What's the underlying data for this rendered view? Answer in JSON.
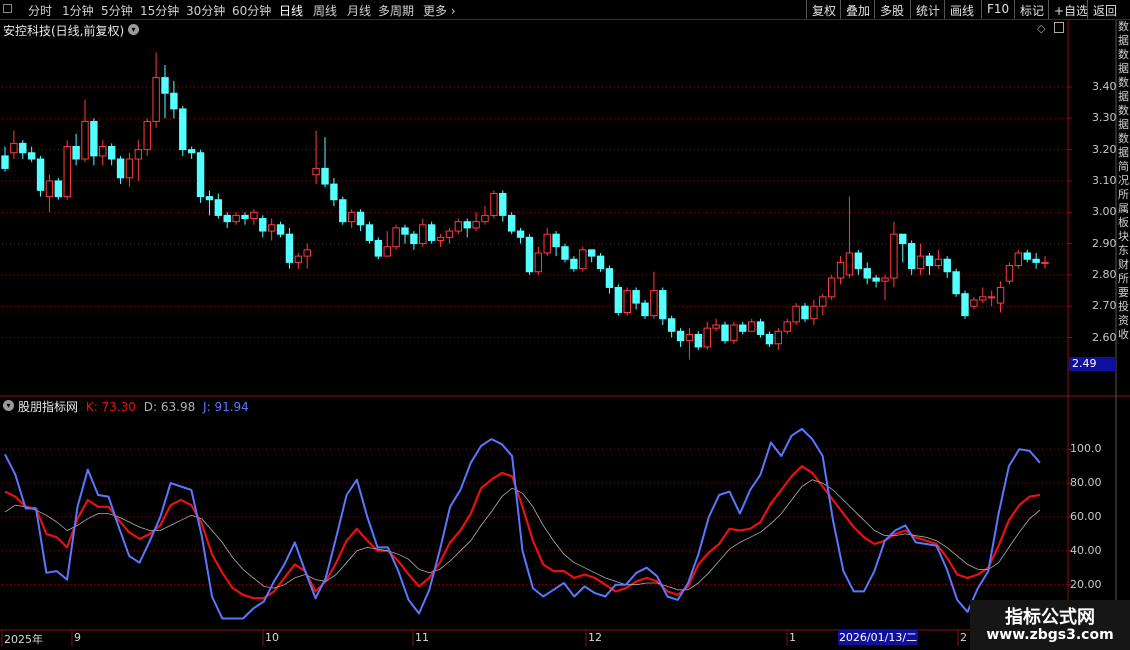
{
  "toolbar": {
    "periods": [
      {
        "label": "分时",
        "active": false
      },
      {
        "label": "1分钟",
        "active": false
      },
      {
        "label": "5分钟",
        "active": false
      },
      {
        "label": "15分钟",
        "active": false
      },
      {
        "label": "30分钟",
        "active": false
      },
      {
        "label": "60分钟",
        "active": false
      },
      {
        "label": "日线",
        "active": true
      },
      {
        "label": "周线",
        "active": false
      },
      {
        "label": "月线",
        "active": false
      },
      {
        "label": "多周期",
        "active": false
      },
      {
        "label": "更多",
        "active": false
      }
    ],
    "right_buttons": [
      "复权",
      "叠加",
      "多股",
      "统计",
      "画线",
      "F10",
      "标记",
      "+自选",
      "返回"
    ]
  },
  "stock": {
    "title": "安控科技(日线,前复权)",
    "current_price_tag": "2.49"
  },
  "indicator": {
    "name": "股朋指标网",
    "k": "K: 73.30",
    "d": "D: 63.98",
    "j": "J: 91.94"
  },
  "colors": {
    "up": "#ff3c3c",
    "down": "#54ffff",
    "k_line": "#e81010",
    "d_line": "#b0b0b0",
    "j_line": "#5a78ff",
    "grid": "#8a1010",
    "price_tag_bg": "#1010a0"
  },
  "price_axis": [
    "3.40",
    "3.30",
    "3.20",
    "3.10",
    "3.00",
    "2.90",
    "2.80",
    "2.70",
    "2.60"
  ],
  "kdj_axis": [
    "100.0",
    "80.00",
    "60.00",
    "40.00",
    "20.00"
  ],
  "date_axis": [
    {
      "label": "2025年"
    },
    {
      "label": "9"
    },
    {
      "label": "10"
    },
    {
      "label": "11"
    },
    {
      "label": "12"
    },
    {
      "label": "1"
    },
    {
      "label": "2"
    }
  ],
  "cursor_date": "2026/01/13/二",
  "side_strip_chars": [
    "数",
    "据",
    "数",
    "据",
    "数",
    "据",
    "数",
    "据",
    "数",
    "据",
    "简",
    "况",
    "所",
    "属",
    "板",
    "块",
    "东",
    "财",
    "所",
    "要",
    "投",
    "资",
    "收"
  ],
  "watermark": {
    "line1": "指标公式网",
    "line2": "www.zbgs3.com"
  },
  "chart_data": [
    {
      "type": "candlestick",
      "title": "安控科技(日线,前复权)",
      "ylim": [
        2.49,
        3.55
      ],
      "candles": [
        [
          3.18,
          3.14,
          3.21,
          3.13
        ],
        [
          3.19,
          3.22,
          3.26,
          3.17
        ],
        [
          3.22,
          3.19,
          3.23,
          3.17
        ],
        [
          3.19,
          3.17,
          3.21,
          3.16
        ],
        [
          3.17,
          3.07,
          3.18,
          3.05
        ],
        [
          3.05,
          3.1,
          3.12,
          3.0
        ],
        [
          3.1,
          3.05,
          3.11,
          3.04
        ],
        [
          3.05,
          3.21,
          3.23,
          3.04
        ],
        [
          3.21,
          3.17,
          3.25,
          3.15
        ],
        [
          3.17,
          3.29,
          3.36,
          3.16
        ],
        [
          3.29,
          3.18,
          3.3,
          3.15
        ],
        [
          3.18,
          3.21,
          3.23,
          3.15
        ],
        [
          3.21,
          3.17,
          3.22,
          3.15
        ],
        [
          3.17,
          3.11,
          3.18,
          3.09
        ],
        [
          3.11,
          3.17,
          3.19,
          3.08
        ],
        [
          3.17,
          3.2,
          3.23,
          3.1
        ],
        [
          3.2,
          3.29,
          3.3,
          3.18
        ],
        [
          3.29,
          3.43,
          3.51,
          3.27
        ],
        [
          3.43,
          3.38,
          3.47,
          3.3
        ],
        [
          3.38,
          3.33,
          3.42,
          3.3
        ],
        [
          3.33,
          3.2,
          3.34,
          3.18
        ],
        [
          3.2,
          3.19,
          3.21,
          3.17
        ],
        [
          3.19,
          3.05,
          3.2,
          3.03
        ],
        [
          3.05,
          3.04,
          3.07,
          2.99
        ],
        [
          3.04,
          2.99,
          3.06,
          2.98
        ],
        [
          2.99,
          2.97,
          3.0,
          2.95
        ],
        [
          2.97,
          2.99,
          3.0,
          2.96
        ],
        [
          2.99,
          2.98,
          3.0,
          2.96
        ],
        [
          2.98,
          3.0,
          3.01,
          2.96
        ],
        [
          2.98,
          2.94,
          2.99,
          2.92
        ],
        [
          2.94,
          2.96,
          2.98,
          2.91
        ],
        [
          2.96,
          2.93,
          2.97,
          2.92
        ],
        [
          2.93,
          2.84,
          2.95,
          2.82
        ],
        [
          2.84,
          2.86,
          2.87,
          2.82
        ],
        [
          2.86,
          2.88,
          2.9,
          2.82
        ],
        [
          3.12,
          3.14,
          3.26,
          3.09
        ],
        [
          3.14,
          3.09,
          3.24,
          3.08
        ],
        [
          3.09,
          3.04,
          3.11,
          3.02
        ],
        [
          3.04,
          2.97,
          3.05,
          2.96
        ],
        [
          2.97,
          3.0,
          3.01,
          2.95
        ],
        [
          3.0,
          2.96,
          3.01,
          2.94
        ],
        [
          2.96,
          2.91,
          2.97,
          2.9
        ],
        [
          2.91,
          2.86,
          2.92,
          2.85
        ],
        [
          2.86,
          2.89,
          2.94,
          2.86
        ],
        [
          2.89,
          2.95,
          2.96,
          2.88
        ],
        [
          2.95,
          2.93,
          2.96,
          2.9
        ],
        [
          2.93,
          2.9,
          2.94,
          2.88
        ],
        [
          2.9,
          2.96,
          2.98,
          2.89
        ],
        [
          2.96,
          2.91,
          2.97,
          2.9
        ],
        [
          2.91,
          2.92,
          2.93,
          2.89
        ],
        [
          2.92,
          2.94,
          2.95,
          2.9
        ],
        [
          2.94,
          2.97,
          2.98,
          2.93
        ],
        [
          2.97,
          2.95,
          2.98,
          2.92
        ],
        [
          2.95,
          2.97,
          3.0,
          2.94
        ],
        [
          2.97,
          2.99,
          3.02,
          2.96
        ],
        [
          2.99,
          3.06,
          3.07,
          2.98
        ],
        [
          3.06,
          2.99,
          3.07,
          2.97
        ],
        [
          2.99,
          2.94,
          3.0,
          2.93
        ],
        [
          2.94,
          2.92,
          2.95,
          2.9
        ],
        [
          2.92,
          2.81,
          2.93,
          2.8
        ],
        [
          2.81,
          2.87,
          2.89,
          2.8
        ],
        [
          2.87,
          2.93,
          2.95,
          2.86
        ],
        [
          2.93,
          2.89,
          2.94,
          2.86
        ],
        [
          2.89,
          2.85,
          2.9,
          2.84
        ],
        [
          2.85,
          2.82,
          2.86,
          2.81
        ],
        [
          2.82,
          2.88,
          2.89,
          2.81
        ],
        [
          2.88,
          2.86,
          2.88,
          2.84
        ],
        [
          2.86,
          2.82,
          2.87,
          2.81
        ],
        [
          2.82,
          2.76,
          2.83,
          2.74
        ],
        [
          2.76,
          2.68,
          2.77,
          2.67
        ],
        [
          2.68,
          2.75,
          2.76,
          2.67
        ],
        [
          2.75,
          2.71,
          2.76,
          2.69
        ],
        [
          2.71,
          2.67,
          2.72,
          2.66
        ],
        [
          2.67,
          2.75,
          2.81,
          2.66
        ],
        [
          2.75,
          2.66,
          2.76,
          2.64
        ],
        [
          2.66,
          2.62,
          2.67,
          2.6
        ],
        [
          2.62,
          2.59,
          2.63,
          2.57
        ],
        [
          2.59,
          2.61,
          2.63,
          2.53
        ],
        [
          2.61,
          2.57,
          2.62,
          2.56
        ],
        [
          2.57,
          2.63,
          2.65,
          2.56
        ],
        [
          2.63,
          2.64,
          2.66,
          2.62
        ],
        [
          2.64,
          2.59,
          2.65,
          2.58
        ],
        [
          2.59,
          2.64,
          2.65,
          2.58
        ],
        [
          2.64,
          2.62,
          2.65,
          2.61
        ],
        [
          2.62,
          2.65,
          2.66,
          2.63
        ],
        [
          2.65,
          2.61,
          2.66,
          2.6
        ],
        [
          2.61,
          2.58,
          2.62,
          2.57
        ],
        [
          2.58,
          2.62,
          2.63,
          2.56
        ],
        [
          2.62,
          2.65,
          2.66,
          2.61
        ],
        [
          2.65,
          2.7,
          2.71,
          2.64
        ],
        [
          2.7,
          2.66,
          2.71,
          2.65
        ],
        [
          2.66,
          2.7,
          2.72,
          2.64
        ],
        [
          2.7,
          2.73,
          2.74,
          2.67
        ],
        [
          2.73,
          2.79,
          2.8,
          2.72
        ],
        [
          2.79,
          2.84,
          2.86,
          2.77
        ],
        [
          2.8,
          2.87,
          3.05,
          2.79
        ],
        [
          2.87,
          2.82,
          2.88,
          2.8
        ],
        [
          2.82,
          2.79,
          2.84,
          2.77
        ],
        [
          2.79,
          2.78,
          2.8,
          2.76
        ],
        [
          2.78,
          2.79,
          2.8,
          2.72
        ],
        [
          2.79,
          2.93,
          2.97,
          2.76
        ],
        [
          2.93,
          2.9,
          2.92,
          2.84
        ],
        [
          2.9,
          2.82,
          2.91,
          2.8
        ],
        [
          2.82,
          2.86,
          2.9,
          2.8
        ],
        [
          2.86,
          2.83,
          2.87,
          2.8
        ],
        [
          2.83,
          2.85,
          2.88,
          2.82
        ],
        [
          2.85,
          2.81,
          2.86,
          2.79
        ],
        [
          2.81,
          2.74,
          2.82,
          2.73
        ],
        [
          2.74,
          2.67,
          2.75,
          2.66
        ],
        [
          2.7,
          2.72,
          2.73,
          2.69
        ],
        [
          2.72,
          2.73,
          2.76,
          2.71
        ],
        [
          2.73,
          2.73,
          2.75,
          2.7
        ],
        [
          2.71,
          2.76,
          2.78,
          2.68
        ],
        [
          2.78,
          2.83,
          2.84,
          2.77
        ],
        [
          2.83,
          2.87,
          2.88,
          2.82
        ],
        [
          2.87,
          2.85,
          2.88,
          2.84
        ],
        [
          2.85,
          2.84,
          2.87,
          2.82
        ],
        [
          2.84,
          2.84,
          2.86,
          2.82
        ]
      ]
    },
    {
      "type": "line",
      "title": "股朋指标网",
      "ylim": [
        -5,
        122
      ],
      "series": [
        {
          "name": "K",
          "values": [
            75,
            72,
            66,
            65,
            50,
            48,
            42,
            59,
            70,
            66,
            66,
            58,
            51,
            47,
            50,
            55,
            67,
            70,
            67,
            56,
            38,
            27,
            18,
            14,
            12,
            12,
            16,
            24,
            32,
            28,
            16,
            22,
            33,
            46,
            53,
            46,
            40,
            40,
            34,
            26,
            19,
            24,
            33,
            45,
            52,
            62,
            77,
            82,
            86,
            84,
            66,
            46,
            32,
            28,
            28,
            24,
            26,
            24,
            20,
            16,
            18,
            22,
            24,
            22,
            16,
            14,
            19,
            32,
            39,
            44,
            53,
            52,
            53,
            57,
            68,
            76,
            84,
            90,
            86,
            78,
            70,
            62,
            54,
            48,
            44,
            46,
            50,
            52,
            48,
            46,
            44,
            36,
            26,
            24,
            26,
            30,
            43,
            58,
            67,
            72,
            73
          ]
        },
        {
          "name": "D",
          "values": [
            63,
            67,
            66,
            64,
            61,
            57,
            52,
            55,
            59,
            62,
            62,
            60,
            57,
            54,
            52,
            52,
            55,
            58,
            61,
            59,
            52,
            45,
            36,
            29,
            24,
            19,
            18,
            20,
            24,
            26,
            23,
            22,
            26,
            33,
            40,
            42,
            41,
            40,
            38,
            35,
            29,
            27,
            29,
            34,
            40,
            46,
            55,
            63,
            72,
            77,
            74,
            66,
            55,
            46,
            38,
            33,
            30,
            27,
            24,
            22,
            20,
            20,
            21,
            21,
            19,
            17,
            17,
            21,
            27,
            34,
            41,
            45,
            48,
            51,
            56,
            62,
            70,
            78,
            82,
            80,
            76,
            70,
            64,
            58,
            52,
            49,
            49,
            50,
            49,
            48,
            46,
            42,
            37,
            32,
            29,
            29,
            33,
            42,
            51,
            59,
            64
          ]
        },
        {
          "name": "J",
          "values": [
            97,
            85,
            65,
            65,
            27,
            28,
            23,
            66,
            88,
            73,
            72,
            54,
            37,
            33,
            46,
            60,
            80,
            78,
            76,
            49,
            13,
            0,
            0,
            0,
            6,
            10,
            22,
            32,
            45,
            28,
            12,
            24,
            48,
            73,
            82,
            60,
            42,
            42,
            28,
            11,
            3,
            17,
            40,
            66,
            76,
            92,
            102,
            106,
            103,
            96,
            40,
            18,
            13,
            17,
            21,
            13,
            19,
            15,
            13,
            20,
            20,
            27,
            30,
            25,
            13,
            11,
            21,
            38,
            60,
            73,
            75,
            62,
            76,
            85,
            104,
            96,
            108,
            112,
            106,
            96,
            58,
            28,
            16,
            16,
            28,
            46,
            52,
            55,
            45,
            44,
            43,
            29,
            11,
            4,
            18,
            28,
            62,
            90,
            100,
            99,
            92
          ]
        }
      ]
    }
  ]
}
